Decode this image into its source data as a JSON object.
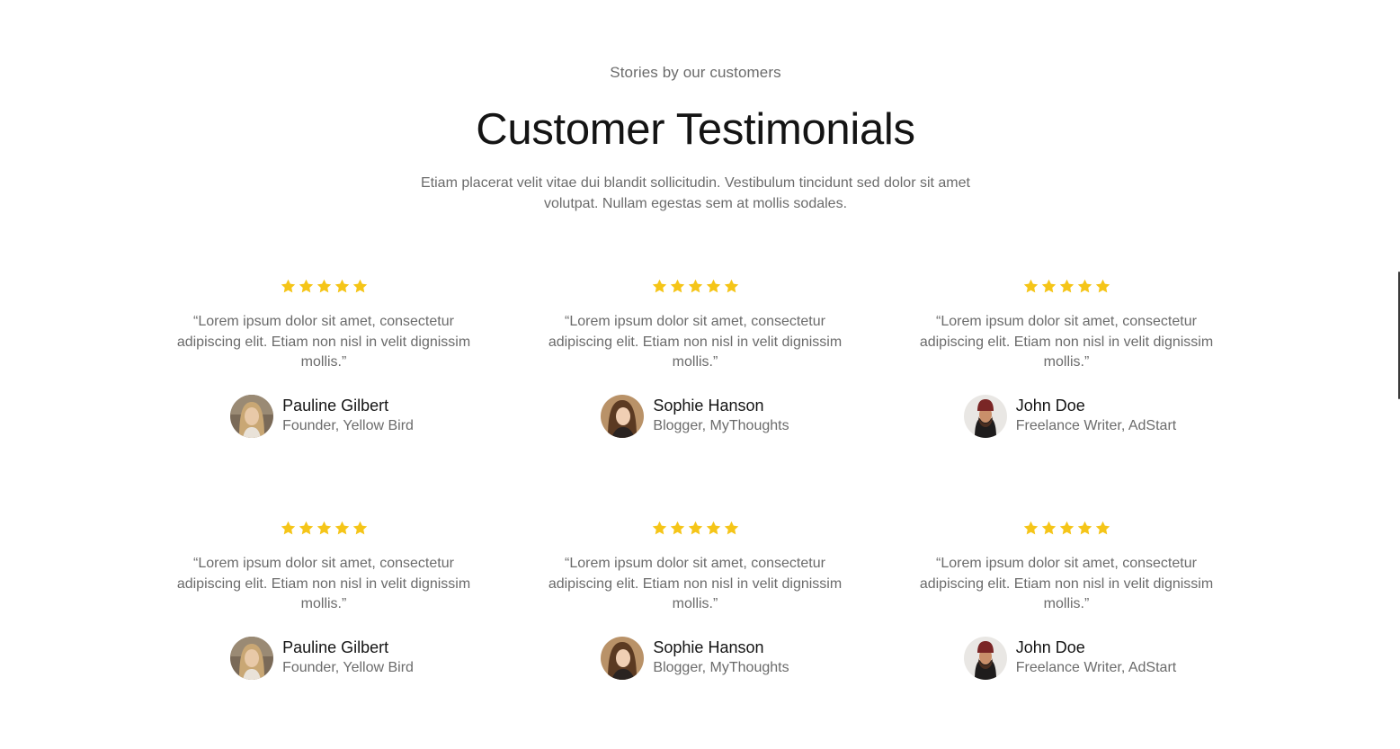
{
  "header": {
    "eyebrow": "Stories by our customers",
    "title": "Customer Testimonials",
    "description": "Etiam placerat velit vitae dui blandit sollicitudin. Vestibulum tincidunt sed dolor sit amet volutpat. Nullam egestas sem at mollis sodales."
  },
  "colors": {
    "star": "#f5c518",
    "title": "#141414",
    "muted": "#6b6b6b"
  },
  "testimonials": [
    {
      "rating": 5,
      "quote": "“Lorem ipsum dolor sit amet, consectetur adipiscing elit. Etiam non nisl in velit dignissim mollis.”",
      "name": "Pauline Gilbert",
      "role": "Founder, Yellow Bird",
      "avatar": "woman-blonde-avatar"
    },
    {
      "rating": 5,
      "quote": "“Lorem ipsum dolor sit amet, consectetur adipiscing elit. Etiam non nisl in velit dignissim mollis.”",
      "name": "Sophie Hanson",
      "role": "Blogger, MyThoughts",
      "avatar": "woman-brunette-avatar"
    },
    {
      "rating": 5,
      "quote": "“Lorem ipsum dolor sit amet, consectetur adipiscing elit. Etiam non nisl in velit dignissim mollis.”",
      "name": "John Doe",
      "role": "Freelance Writer, AdStart",
      "avatar": "man-beanie-avatar"
    },
    {
      "rating": 5,
      "quote": "“Lorem ipsum dolor sit amet, consectetur adipiscing elit. Etiam non nisl in velit dignissim mollis.”",
      "name": "Pauline Gilbert",
      "role": "Founder, Yellow Bird",
      "avatar": "woman-blonde-avatar"
    },
    {
      "rating": 5,
      "quote": "“Lorem ipsum dolor sit amet, consectetur adipiscing elit. Etiam non nisl in velit dignissim mollis.”",
      "name": "Sophie Hanson",
      "role": "Blogger, MyThoughts",
      "avatar": "woman-brunette-avatar"
    },
    {
      "rating": 5,
      "quote": "“Lorem ipsum dolor sit amet, consectetur adipiscing elit. Etiam non nisl in velit dignissim mollis.”",
      "name": "John Doe",
      "role": "Freelance Writer, AdStart",
      "avatar": "man-beanie-avatar"
    }
  ]
}
